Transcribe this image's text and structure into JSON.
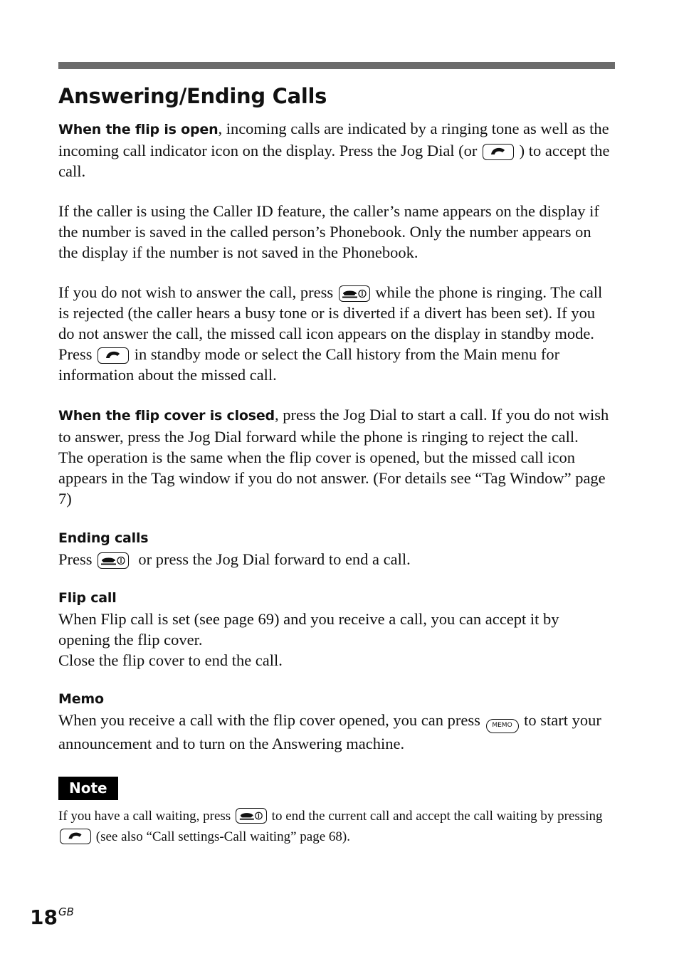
{
  "header": {
    "title": "Answering/Ending Calls"
  },
  "icons": {
    "send_key": "send-key-icon",
    "end_key": "end-power-key-icon",
    "memo_key_label": "MEMO"
  },
  "sections": {
    "flip_open": {
      "lead": "When the flip is open",
      "text_1": ", incoming calls are indicated by a ringing tone as well as the incoming call indicator icon on the display. Press the Jog Dial (or ",
      "text_2": " ) to accept the call."
    },
    "caller_id": {
      "text": "If the caller is using the Caller ID feature, the caller’s name appears on the display if the number is saved in the called person’s Phonebook. Only the number appears on the display if the number is not saved in the Phonebook."
    },
    "reject": {
      "text_1": "If you do not wish to answer the call, press ",
      "text_2": " while the phone is ringing. The call is rejected (the caller hears a busy tone or is diverted if a divert has been set). If you do not answer the call, the missed call icon appears on the display in standby mode. Press ",
      "text_3": " in standby mode or select the Call history from the Main menu for information about the missed call."
    },
    "flip_closed": {
      "lead": "When the flip cover is closed",
      "text_1": ", press the Jog Dial to start a call. If you do not wish to answer, press the Jog Dial forward while the phone is ringing to reject the call.",
      "text_2": "The operation is the same when the flip cover is opened, but the missed call icon appears in the Tag window if you do not answer. (For details see “Tag Window” page 7)"
    },
    "ending_calls": {
      "heading": "Ending calls",
      "text_1": "Press ",
      "text_2": "  or press the Jog Dial forward to end a call."
    },
    "flip_call": {
      "heading": "Flip call",
      "text_1": "When Flip call is set (see page 69) and you receive a call, you can accept it by opening the flip cover.",
      "text_2": "Close the flip cover to end the call."
    },
    "memo": {
      "heading": "Memo",
      "text_1": "When you receive a call with the flip cover opened, you can press ",
      "text_2": " to start your announcement and to turn on the Answering machine."
    }
  },
  "note": {
    "label": "Note",
    "text_1": "If you have a call waiting, press ",
    "text_2": " to end the current call and accept the call waiting by pressing ",
    "text_3": " (see also “Call settings-Call waiting” page 68)."
  },
  "footer": {
    "page_number": "18",
    "region_code": "GB"
  }
}
